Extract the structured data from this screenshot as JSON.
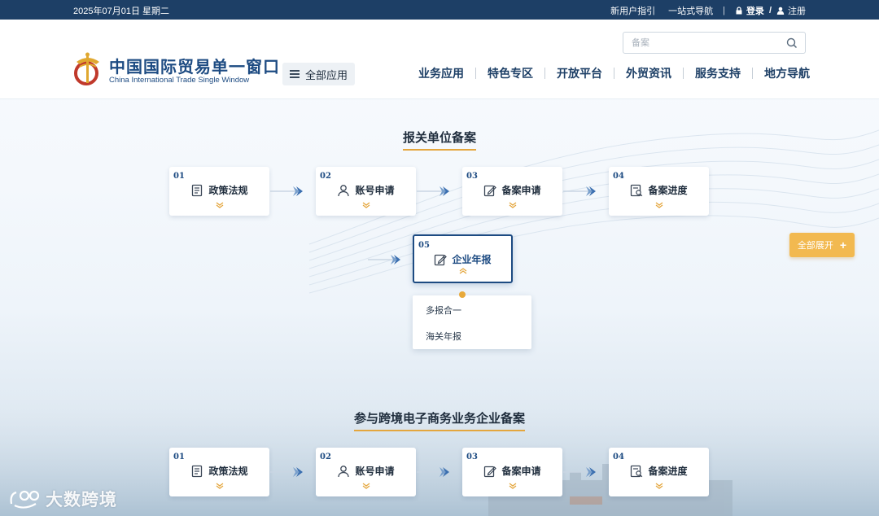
{
  "topbar": {
    "date": "2025年07月01日 星期二",
    "new_user_guide": "新用户指引",
    "one_stop_nav": "一站式导航",
    "login": "登录",
    "slash": "/",
    "register": "注册"
  },
  "header": {
    "search_placeholder": "备案",
    "logo_cn": "中国国际贸易单一窗口",
    "logo_en": "China International Trade Single Window",
    "all_apps": "全部应用",
    "nav": [
      "业务应用",
      "特色专区",
      "开放平台",
      "外贸资讯",
      "服务支持",
      "地方导航"
    ]
  },
  "section1": {
    "title": "报关单位备案",
    "steps": [
      {
        "num": "01",
        "label": "政策法规",
        "icon": "document-list-icon"
      },
      {
        "num": "02",
        "label": "账号申请",
        "icon": "user-icon"
      },
      {
        "num": "03",
        "label": "备案申请",
        "icon": "edit-form-icon"
      },
      {
        "num": "04",
        "label": "备案进度",
        "icon": "progress-search-icon"
      },
      {
        "num": "05",
        "label": "企业年报",
        "icon": "edit-form-icon"
      }
    ],
    "dropdown": [
      "多报合一",
      "海关年报"
    ],
    "expand_all": "全部展开",
    "expand_plus": "+"
  },
  "section2": {
    "title": "参与跨境电子商务业务企业备案",
    "steps": [
      {
        "num": "01",
        "label": "政策法规",
        "icon": "document-list-icon"
      },
      {
        "num": "02",
        "label": "账号申请",
        "icon": "user-icon"
      },
      {
        "num": "03",
        "label": "备案申请",
        "icon": "edit-form-icon"
      },
      {
        "num": "04",
        "label": "备案进度",
        "icon": "progress-search-icon"
      }
    ]
  },
  "watermark": "大数跨境",
  "colors": {
    "topbar_bg": "#1d3f66",
    "brand_blue": "#1d4b82",
    "accent_gold": "#e4a63d",
    "expand_button": "#f2b950"
  }
}
